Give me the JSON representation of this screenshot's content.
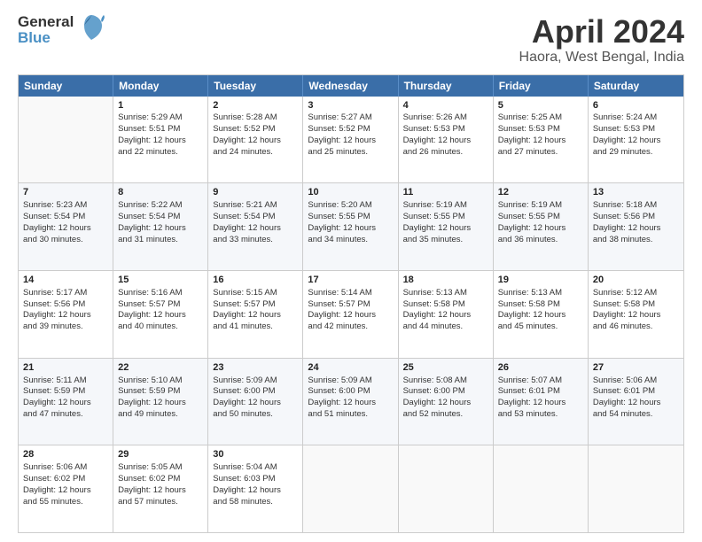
{
  "logo": {
    "line1": "General",
    "line2": "Blue"
  },
  "title": "April 2024",
  "subtitle": "Haora, West Bengal, India",
  "header_days": [
    "Sunday",
    "Monday",
    "Tuesday",
    "Wednesday",
    "Thursday",
    "Friday",
    "Saturday"
  ],
  "weeks": [
    [
      {
        "day": "",
        "lines": []
      },
      {
        "day": "1",
        "lines": [
          "Sunrise: 5:29 AM",
          "Sunset: 5:51 PM",
          "Daylight: 12 hours",
          "and 22 minutes."
        ]
      },
      {
        "day": "2",
        "lines": [
          "Sunrise: 5:28 AM",
          "Sunset: 5:52 PM",
          "Daylight: 12 hours",
          "and 24 minutes."
        ]
      },
      {
        "day": "3",
        "lines": [
          "Sunrise: 5:27 AM",
          "Sunset: 5:52 PM",
          "Daylight: 12 hours",
          "and 25 minutes."
        ]
      },
      {
        "day": "4",
        "lines": [
          "Sunrise: 5:26 AM",
          "Sunset: 5:53 PM",
          "Daylight: 12 hours",
          "and 26 minutes."
        ]
      },
      {
        "day": "5",
        "lines": [
          "Sunrise: 5:25 AM",
          "Sunset: 5:53 PM",
          "Daylight: 12 hours",
          "and 27 minutes."
        ]
      },
      {
        "day": "6",
        "lines": [
          "Sunrise: 5:24 AM",
          "Sunset: 5:53 PM",
          "Daylight: 12 hours",
          "and 29 minutes."
        ]
      }
    ],
    [
      {
        "day": "7",
        "lines": [
          "Sunrise: 5:23 AM",
          "Sunset: 5:54 PM",
          "Daylight: 12 hours",
          "and 30 minutes."
        ]
      },
      {
        "day": "8",
        "lines": [
          "Sunrise: 5:22 AM",
          "Sunset: 5:54 PM",
          "Daylight: 12 hours",
          "and 31 minutes."
        ]
      },
      {
        "day": "9",
        "lines": [
          "Sunrise: 5:21 AM",
          "Sunset: 5:54 PM",
          "Daylight: 12 hours",
          "and 33 minutes."
        ]
      },
      {
        "day": "10",
        "lines": [
          "Sunrise: 5:20 AM",
          "Sunset: 5:55 PM",
          "Daylight: 12 hours",
          "and 34 minutes."
        ]
      },
      {
        "day": "11",
        "lines": [
          "Sunrise: 5:19 AM",
          "Sunset: 5:55 PM",
          "Daylight: 12 hours",
          "and 35 minutes."
        ]
      },
      {
        "day": "12",
        "lines": [
          "Sunrise: 5:19 AM",
          "Sunset: 5:55 PM",
          "Daylight: 12 hours",
          "and 36 minutes."
        ]
      },
      {
        "day": "13",
        "lines": [
          "Sunrise: 5:18 AM",
          "Sunset: 5:56 PM",
          "Daylight: 12 hours",
          "and 38 minutes."
        ]
      }
    ],
    [
      {
        "day": "14",
        "lines": [
          "Sunrise: 5:17 AM",
          "Sunset: 5:56 PM",
          "Daylight: 12 hours",
          "and 39 minutes."
        ]
      },
      {
        "day": "15",
        "lines": [
          "Sunrise: 5:16 AM",
          "Sunset: 5:57 PM",
          "Daylight: 12 hours",
          "and 40 minutes."
        ]
      },
      {
        "day": "16",
        "lines": [
          "Sunrise: 5:15 AM",
          "Sunset: 5:57 PM",
          "Daylight: 12 hours",
          "and 41 minutes."
        ]
      },
      {
        "day": "17",
        "lines": [
          "Sunrise: 5:14 AM",
          "Sunset: 5:57 PM",
          "Daylight: 12 hours",
          "and 42 minutes."
        ]
      },
      {
        "day": "18",
        "lines": [
          "Sunrise: 5:13 AM",
          "Sunset: 5:58 PM",
          "Daylight: 12 hours",
          "and 44 minutes."
        ]
      },
      {
        "day": "19",
        "lines": [
          "Sunrise: 5:13 AM",
          "Sunset: 5:58 PM",
          "Daylight: 12 hours",
          "and 45 minutes."
        ]
      },
      {
        "day": "20",
        "lines": [
          "Sunrise: 5:12 AM",
          "Sunset: 5:58 PM",
          "Daylight: 12 hours",
          "and 46 minutes."
        ]
      }
    ],
    [
      {
        "day": "21",
        "lines": [
          "Sunrise: 5:11 AM",
          "Sunset: 5:59 PM",
          "Daylight: 12 hours",
          "and 47 minutes."
        ]
      },
      {
        "day": "22",
        "lines": [
          "Sunrise: 5:10 AM",
          "Sunset: 5:59 PM",
          "Daylight: 12 hours",
          "and 49 minutes."
        ]
      },
      {
        "day": "23",
        "lines": [
          "Sunrise: 5:09 AM",
          "Sunset: 6:00 PM",
          "Daylight: 12 hours",
          "and 50 minutes."
        ]
      },
      {
        "day": "24",
        "lines": [
          "Sunrise: 5:09 AM",
          "Sunset: 6:00 PM",
          "Daylight: 12 hours",
          "and 51 minutes."
        ]
      },
      {
        "day": "25",
        "lines": [
          "Sunrise: 5:08 AM",
          "Sunset: 6:00 PM",
          "Daylight: 12 hours",
          "and 52 minutes."
        ]
      },
      {
        "day": "26",
        "lines": [
          "Sunrise: 5:07 AM",
          "Sunset: 6:01 PM",
          "Daylight: 12 hours",
          "and 53 minutes."
        ]
      },
      {
        "day": "27",
        "lines": [
          "Sunrise: 5:06 AM",
          "Sunset: 6:01 PM",
          "Daylight: 12 hours",
          "and 54 minutes."
        ]
      }
    ],
    [
      {
        "day": "28",
        "lines": [
          "Sunrise: 5:06 AM",
          "Sunset: 6:02 PM",
          "Daylight: 12 hours",
          "and 55 minutes."
        ]
      },
      {
        "day": "29",
        "lines": [
          "Sunrise: 5:05 AM",
          "Sunset: 6:02 PM",
          "Daylight: 12 hours",
          "and 57 minutes."
        ]
      },
      {
        "day": "30",
        "lines": [
          "Sunrise: 5:04 AM",
          "Sunset: 6:03 PM",
          "Daylight: 12 hours",
          "and 58 minutes."
        ]
      },
      {
        "day": "",
        "lines": []
      },
      {
        "day": "",
        "lines": []
      },
      {
        "day": "",
        "lines": []
      },
      {
        "day": "",
        "lines": []
      }
    ]
  ]
}
